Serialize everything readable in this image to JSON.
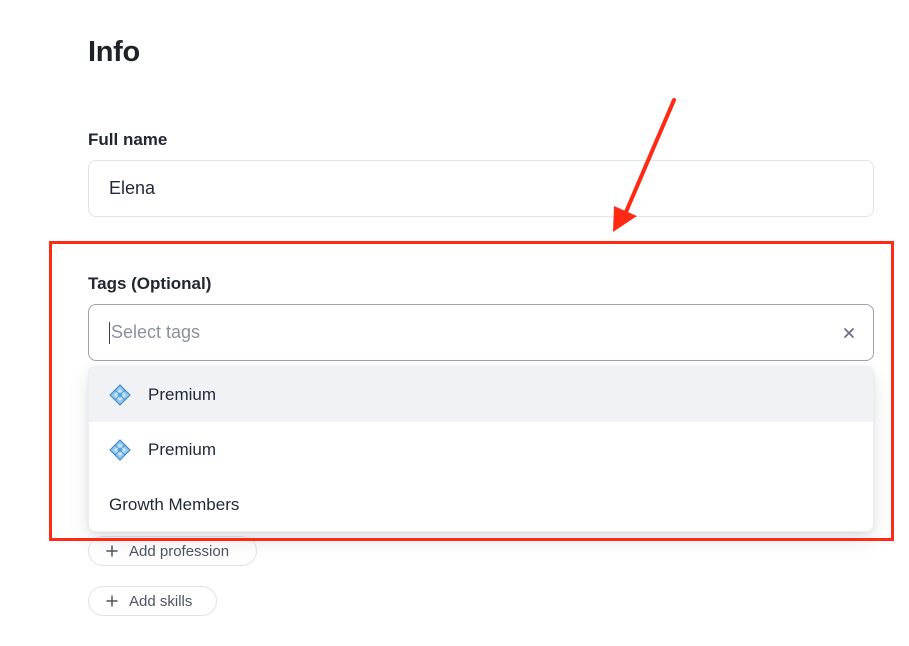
{
  "section": {
    "title": "Info"
  },
  "full_name": {
    "label": "Full name",
    "value": "Elena"
  },
  "tags": {
    "label": "Tags (Optional)",
    "placeholder": "Select tags",
    "clear_icon": "close-icon",
    "options": [
      {
        "label": "Premium",
        "icon": "diamond-icon",
        "highlighted": true
      },
      {
        "label": "Premium",
        "icon": "diamond-icon",
        "highlighted": false
      },
      {
        "label": "Growth Members",
        "icon": null,
        "highlighted": false
      }
    ]
  },
  "actions": {
    "add_profession": "Add profession",
    "add_skills": "Add skills"
  },
  "annotation": {
    "color": "#ff2a13"
  }
}
